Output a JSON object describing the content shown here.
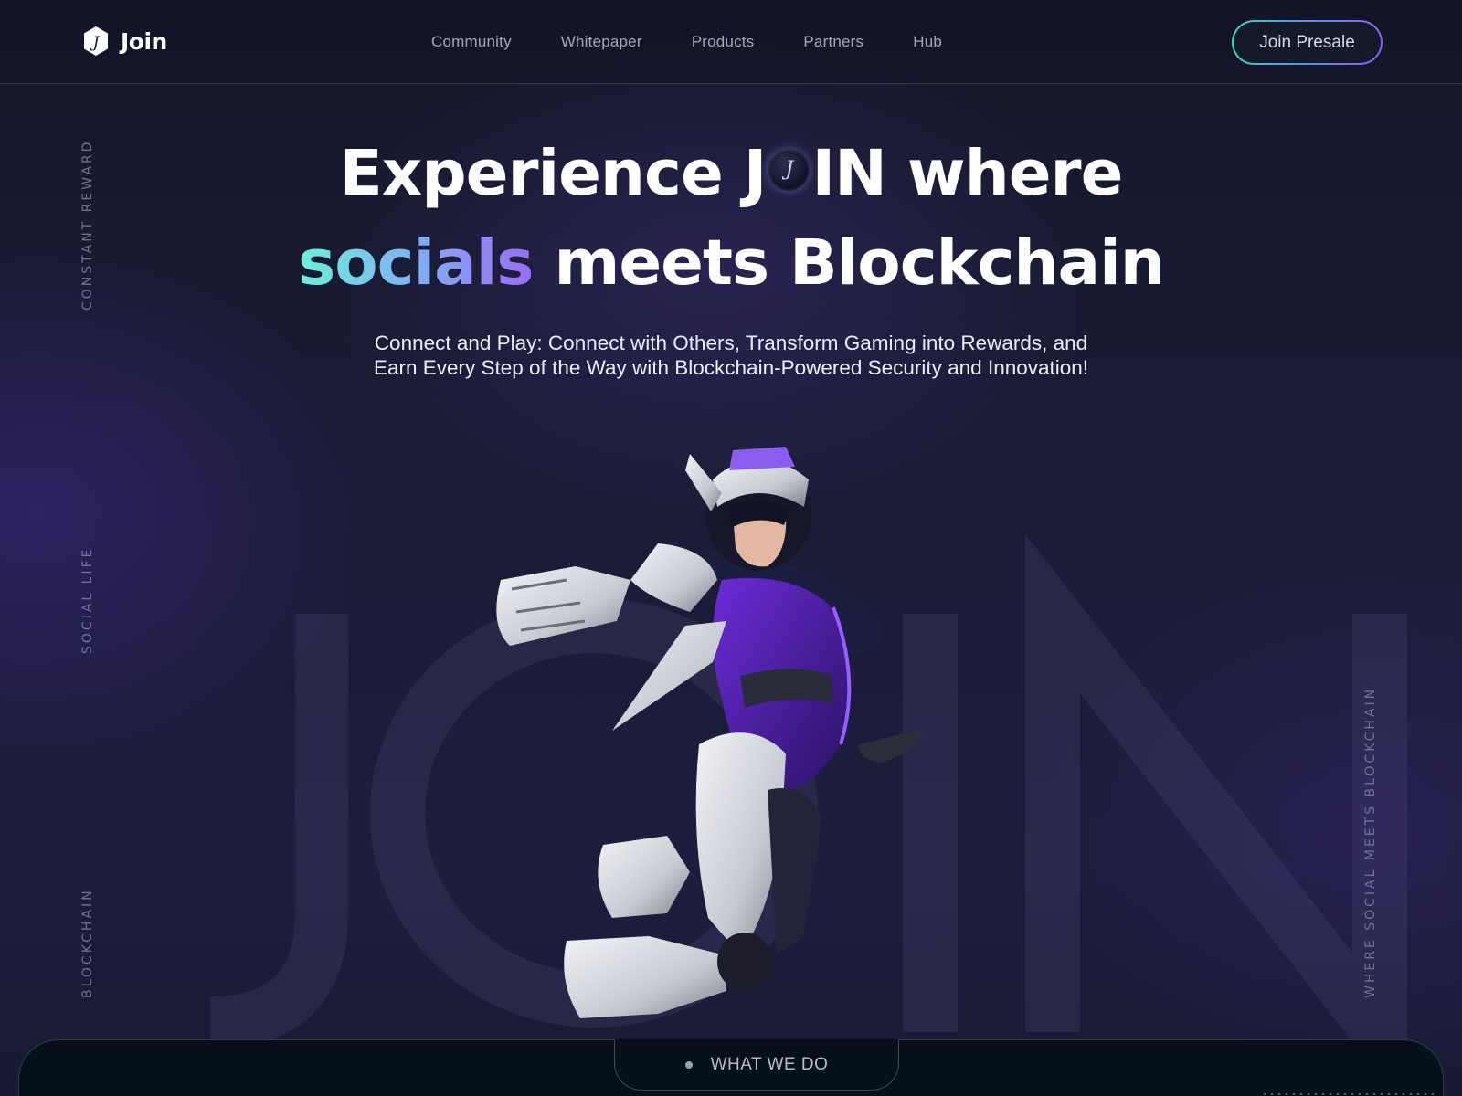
{
  "brand": {
    "name": "Join",
    "logo_icon": "join-hexagon-logo-icon"
  },
  "nav": {
    "items": [
      "Community",
      "Whitepaper",
      "Products",
      "Partners",
      "Hub"
    ],
    "cta_label": "Join Presale"
  },
  "side_labels": {
    "left_top": "CONSTANT REWARD",
    "left_middle": "SOCIAL LIFE",
    "left_bottom": "BLOCKCHAIN",
    "right": "WHERE SOCIAL MEETS BLOCKCHAIN"
  },
  "hero": {
    "line1_before": "Experience J",
    "line1_after": "IN where",
    "line2_highlight": "socials",
    "line2_rest": " meets Blockchain",
    "subtitle_line1": "Connect and Play: Connect with Others, Transform Gaming into Rewards, and",
    "subtitle_line2": "Earn Every Step of the Way with Blockchain-Powered Security and Innovation!",
    "background_word": "JOIN"
  },
  "section": {
    "label": "WHAT WE DO"
  },
  "colors": {
    "background": "#17192e",
    "gradient_start": "#6ff0d8",
    "gradient_mid": "#7eb6f2",
    "gradient_end": "#9a6cf5",
    "nav_text": "#a6a9bd",
    "accent_purple": "#6c2bd9"
  }
}
